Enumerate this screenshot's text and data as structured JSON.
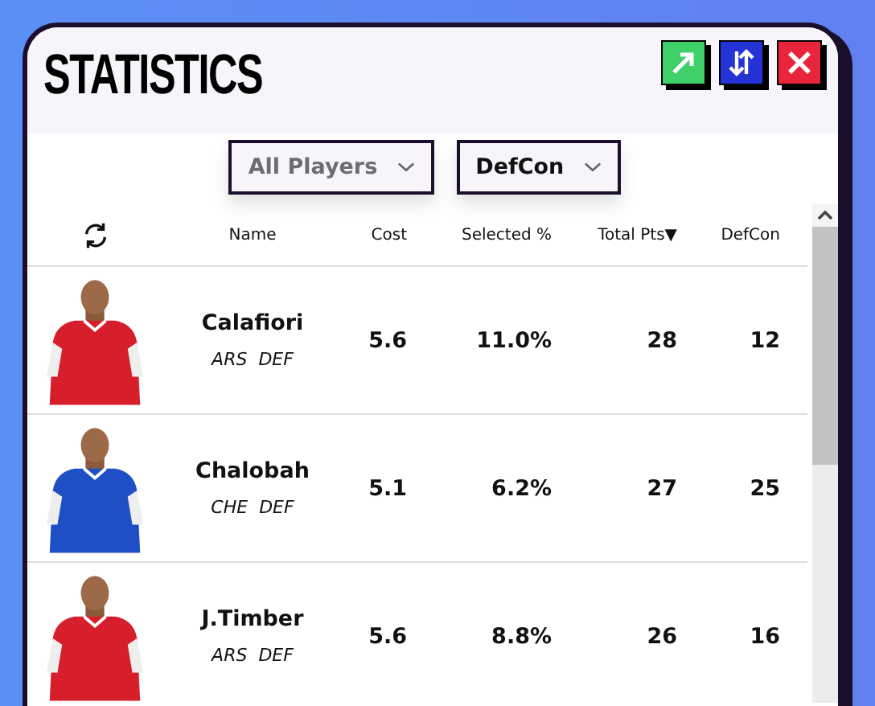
{
  "window": {
    "title": "STATISTICS",
    "buttons": [
      {
        "kind": "expand"
      },
      {
        "kind": "sort"
      },
      {
        "kind": "close"
      }
    ]
  },
  "filters": [
    {
      "value": "All Players",
      "muted": true
    },
    {
      "value": "DefCon",
      "muted": false
    }
  ],
  "table": {
    "columns": [
      "Name",
      "Cost",
      "Selected %",
      "Total Pts▼",
      "DefCon"
    ],
    "rows": [
      {
        "color": "#d71f2b",
        "name": "Calafiori",
        "team": "ARS",
        "position": "DEF",
        "cost": "5.6",
        "selected": "11.0%",
        "total_pts": "28",
        "defcon": "12"
      },
      {
        "color": "#1f4fc4",
        "name": "Chalobah",
        "team": "CHE",
        "position": "DEF",
        "cost": "5.1",
        "selected": "6.2%",
        "total_pts": "27",
        "defcon": "25"
      },
      {
        "color": "#d71f2b",
        "name": "J.Timber",
        "team": "ARS",
        "position": "DEF",
        "cost": "5.6",
        "selected": "8.8%",
        "total_pts": "26",
        "defcon": "16"
      }
    ]
  }
}
